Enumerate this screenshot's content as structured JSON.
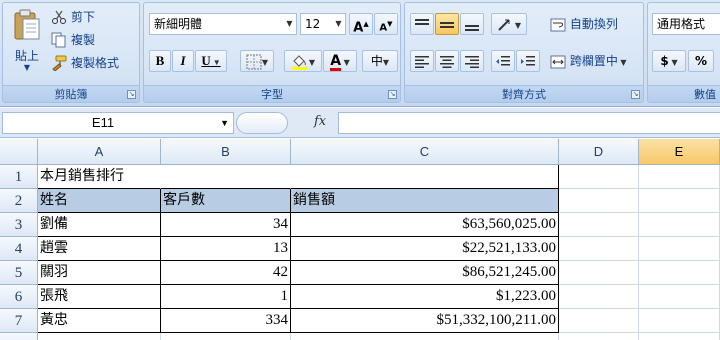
{
  "ribbon": {
    "clipboard": {
      "paste_label": "貼上",
      "cut_label": "剪下",
      "copy_label": "複製",
      "format_painter_label": "複製格式",
      "group_label": "剪貼簿"
    },
    "font": {
      "font_name": "新細明體",
      "font_size": "12",
      "grow_label": "A",
      "shrink_label": "A",
      "bold_label": "B",
      "italic_label": "I",
      "underline_label": "U",
      "font_color_label": "A",
      "phonetic_label": "中",
      "group_label": "字型",
      "font_color": "#e00000",
      "fill_color": "#ffff00"
    },
    "alignment": {
      "wrap_text_label": "自動換列",
      "merge_center_label": "跨欄置中",
      "group_label": "對齊方式"
    },
    "number": {
      "format": "通用格式",
      "currency_label": "$",
      "percent_label": "%",
      "group_label": "數值"
    }
  },
  "formula_bar": {
    "name_box": "E11",
    "fx_label": "fx",
    "formula": ""
  },
  "sheet": {
    "columns": [
      "A",
      "B",
      "C",
      "D",
      "E"
    ],
    "selected_column": "E",
    "rows": [
      {
        "num": "1",
        "a": "本月銷售排行",
        "b": "",
        "c": ""
      },
      {
        "num": "2",
        "a": "姓名",
        "b": "客戶數",
        "c": "銷售額"
      },
      {
        "num": "3",
        "a": "劉備",
        "b": "34",
        "c": "$63,560,025.00"
      },
      {
        "num": "4",
        "a": "趙雲",
        "b": "13",
        "c": "$22,521,133.00"
      },
      {
        "num": "5",
        "a": "關羽",
        "b": "42",
        "c": "$86,521,245.00"
      },
      {
        "num": "6",
        "a": "張飛",
        "b": "1",
        "c": "$1,223.00"
      },
      {
        "num": "7",
        "a": "黃忠",
        "b": "334",
        "c": "$51,332,100,211.00"
      }
    ]
  }
}
